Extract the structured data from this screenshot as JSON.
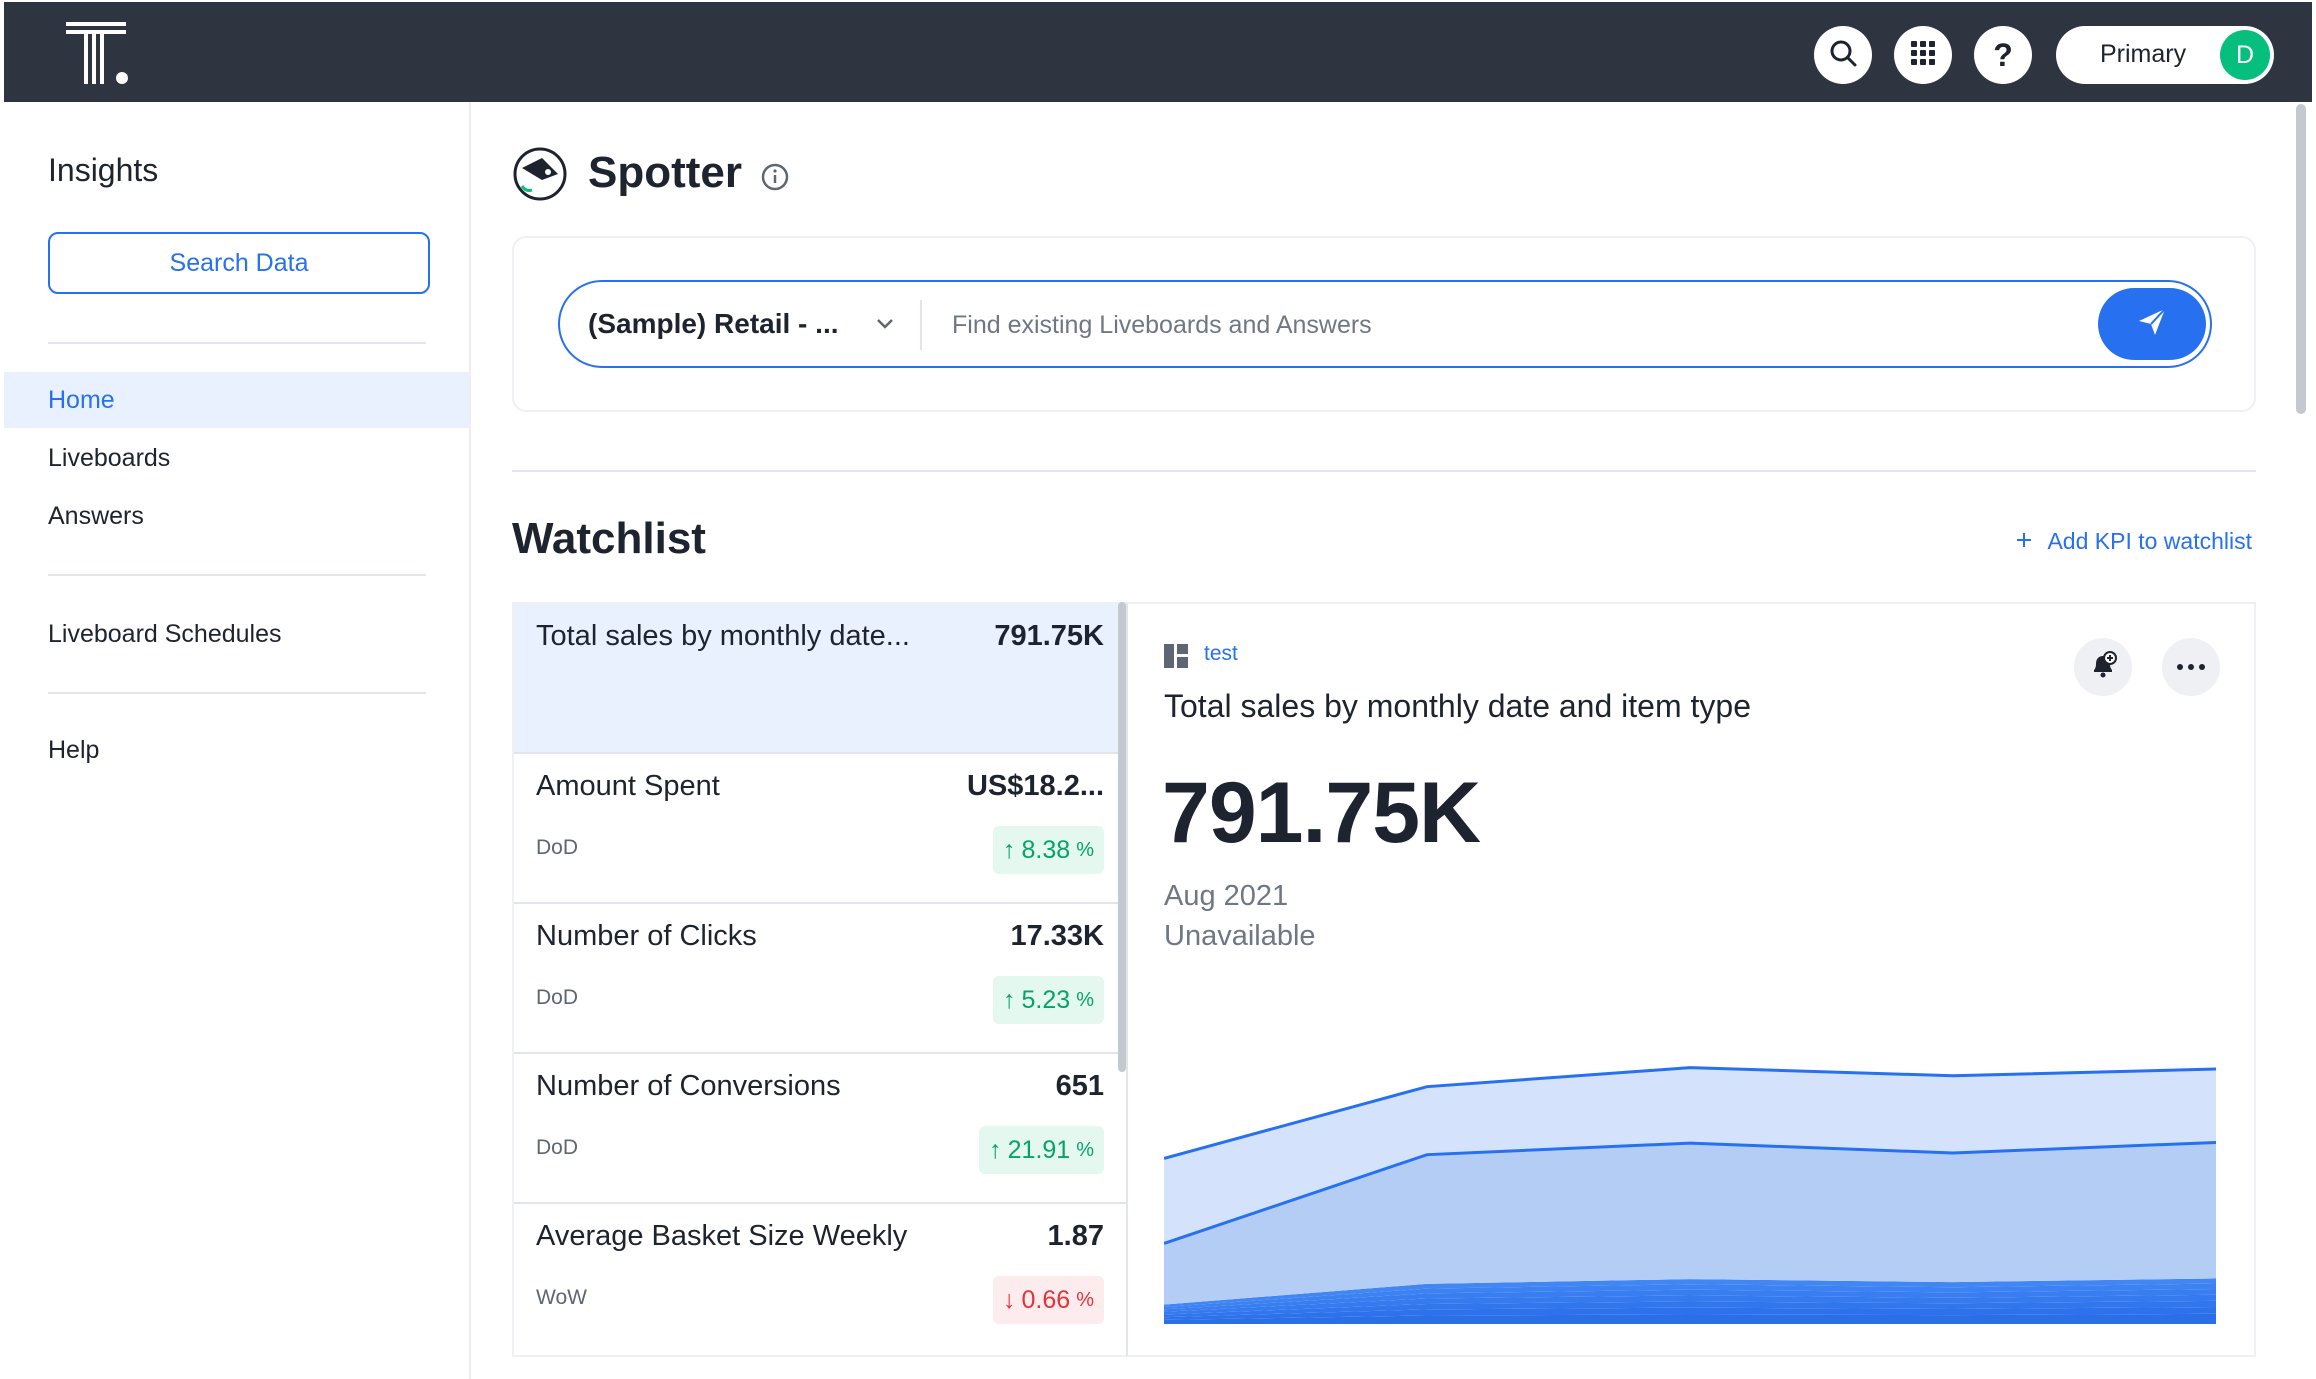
{
  "topbar": {
    "org_label": "Primary",
    "avatar_initial": "D",
    "icons": [
      "search-icon",
      "apps-grid-icon",
      "help-icon"
    ]
  },
  "sidebar": {
    "title": "Insights",
    "search_button": "Search Data",
    "items": [
      {
        "label": "Home",
        "active": true
      },
      {
        "label": "Liveboards"
      },
      {
        "label": "Answers"
      },
      {
        "label": "Liveboard Schedules"
      },
      {
        "label": "Help"
      }
    ]
  },
  "spotter": {
    "title": "Spotter",
    "datasource": "(Sample) Retail - ...",
    "search_placeholder": "Find existing Liveboards and Answers"
  },
  "watchlist": {
    "title": "Watchlist",
    "add_kpi": "Add KPI to watchlist",
    "items": [
      {
        "name": "Total sales by monthly date...",
        "value": "791.75K",
        "selected": true
      },
      {
        "name": "Amount Spent",
        "value": "US$18.2...",
        "period": "DoD",
        "change": "8.38",
        "unit": "%",
        "arrow": "↑",
        "direction": "up"
      },
      {
        "name": "Number of Clicks",
        "value": "17.33K",
        "period": "DoD",
        "change": "5.23",
        "unit": "%",
        "arrow": "↑",
        "direction": "up"
      },
      {
        "name": "Number of Conversions",
        "value": "651",
        "period": "DoD",
        "change": "21.91",
        "unit": "%",
        "arrow": "↑",
        "direction": "up"
      },
      {
        "name": "Average Basket Size Weekly",
        "value": "1.87",
        "period": "WoW",
        "change": "0.66",
        "unit": "%",
        "arrow": "↓",
        "direction": "down"
      }
    ]
  },
  "detail": {
    "source": "test",
    "title": "Total sales by monthly date and item type",
    "value": "791.75K",
    "date": "Aug 2021",
    "change": "Unavailable"
  },
  "chart_data": {
    "type": "area",
    "stacked": true,
    "x": [
      1,
      2,
      3,
      4,
      5
    ],
    "ylim": [
      0,
      1000
    ],
    "series": [
      {
        "values": [
          12,
          25,
          28,
          26,
          30
        ]
      },
      {
        "values": [
          8,
          18,
          20,
          18,
          20
        ]
      },
      {
        "values": [
          8,
          16,
          18,
          17,
          18
        ]
      },
      {
        "values": [
          8,
          16,
          18,
          16,
          18
        ]
      },
      {
        "values": [
          7,
          15,
          17,
          16,
          17
        ]
      },
      {
        "values": [
          7,
          14,
          16,
          15,
          16
        ]
      },
      {
        "values": [
          7,
          14,
          15,
          15,
          15
        ]
      },
      {
        "values": [
          180,
          380,
          400,
          380,
          400
        ]
      },
      {
        "values": [
          250,
          200,
          222,
          227,
          216
        ]
      }
    ],
    "colors": [
      "#2a6ee8",
      "#2d72ea",
      "#3176ec",
      "#357aee",
      "#397ef0",
      "#3d82f2",
      "#4186f3",
      "#b3cdf5",
      "#d4e3fb"
    ],
    "line_color": "#2770ef",
    "grid": false
  }
}
